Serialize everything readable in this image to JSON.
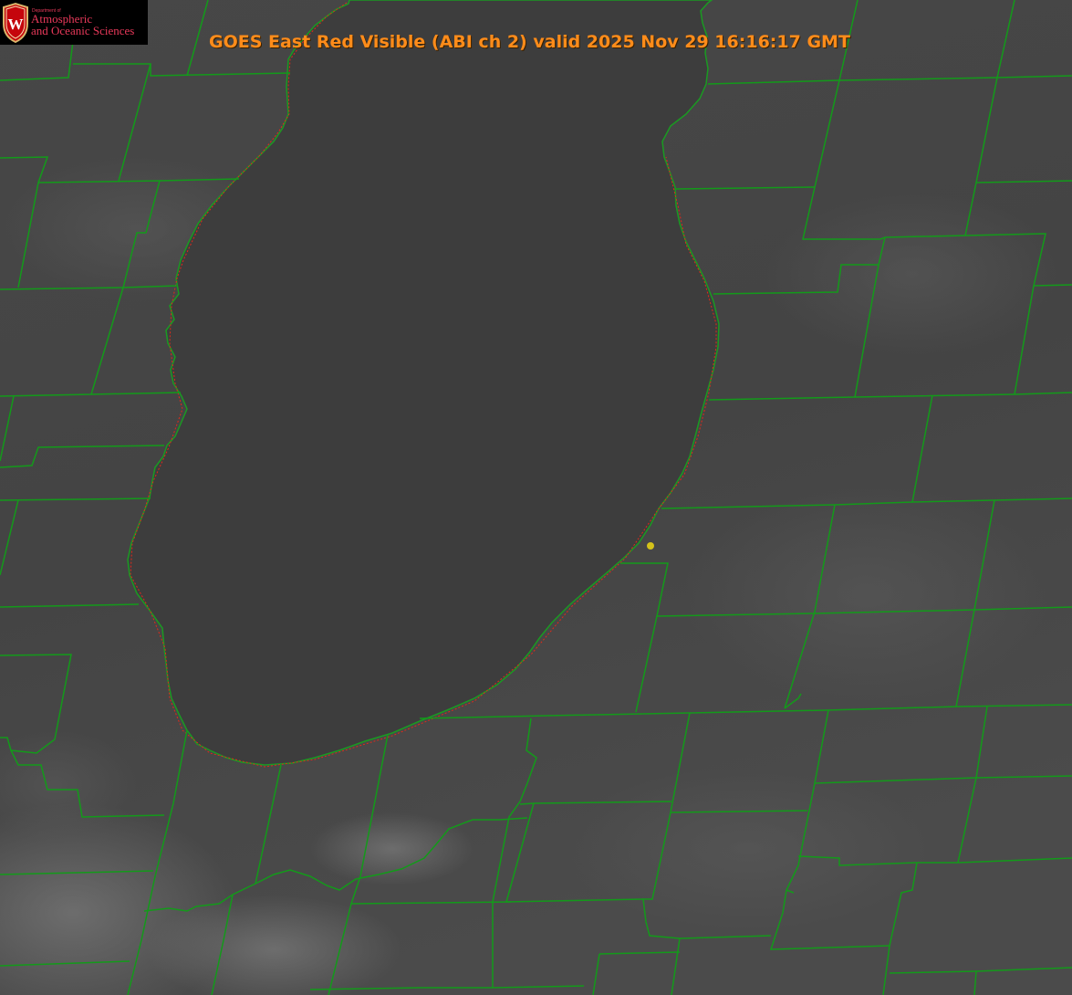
{
  "map": {
    "title": "GOES East Red Visible (ABI ch 2) valid 2025 Nov 29 16:16:17 GMT",
    "logo": {
      "department": "Department of",
      "name_line1": "Atmospheric",
      "name_line2": "and Oceanic Sciences",
      "crest_letter": "W"
    },
    "colors": {
      "title": "#ff8c1a",
      "boundaries": "#139a1a",
      "state_boundary_dash": "#e02a1a",
      "marker": "#d4c21a",
      "logo_text": "#e8395a",
      "crest": "#c5050c"
    },
    "icons": {
      "crest": "university-crest-icon",
      "marker": "location-dot-icon"
    }
  }
}
